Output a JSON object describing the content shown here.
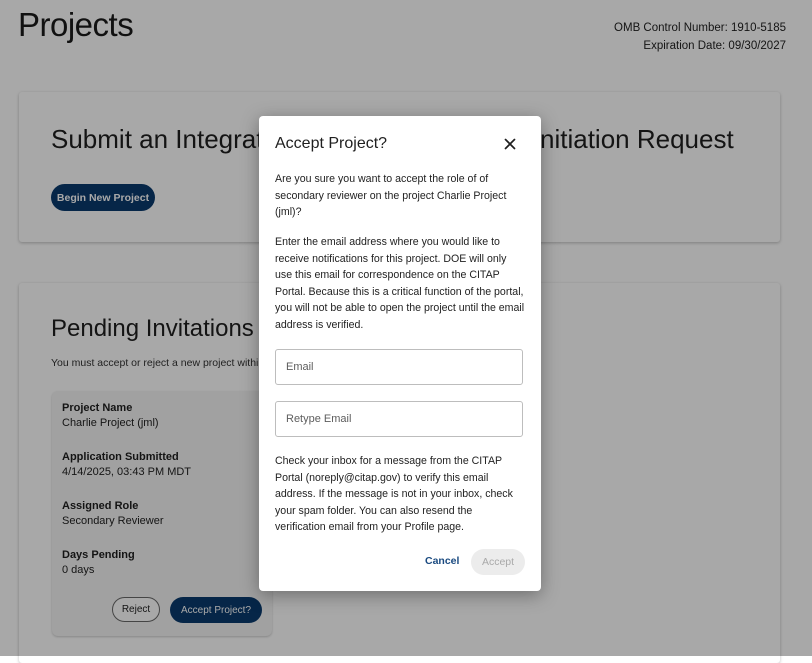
{
  "page": {
    "title": "Projects",
    "omb": {
      "control_number": "OMB Control Number: 1910-5185",
      "expiration": "Expiration Date: 09/30/2027"
    }
  },
  "submit_card": {
    "heading_left": "Submit an Integrated",
    "heading_right": "nitiation Request",
    "begin_button": "Begin New Project"
  },
  "pending": {
    "heading": "Pending Invitations",
    "note": "You must accept or reject a new project within",
    "invitation": {
      "project_name_label": "Project Name",
      "project_name_value": "Charlie Project (jml)",
      "submitted_label": "Application Submitted",
      "submitted_value": "4/14/2025, 03:43 PM MDT",
      "role_label": "Assigned Role",
      "role_value": "Secondary Reviewer",
      "days_label": "Days Pending",
      "days_value": "0 days",
      "reject_button": "Reject",
      "accept_button": "Accept Project?"
    }
  },
  "modal": {
    "title": "Accept Project?",
    "close_icon": "close-icon",
    "confirm_text": "Are you sure you want to accept the role of of secondary reviewer on the project Charlie Project (jml)?",
    "email_instructions": "Enter the email address where you would like to receive notifications for this project. DOE will only use this email for correspondence on the CITAP Portal. Because this is a critical function of the portal, you will not be able to open the project until the email address is verified.",
    "email_placeholder": "Email",
    "email_value": "",
    "retype_placeholder": "Retype Email",
    "retype_value": "",
    "verify_text": "Check your inbox for a message from the CITAP Portal (noreply@citap.gov) to verify this email address. If the message is not in your inbox, check your spam folder. You can also resend the verification email from your Profile page.",
    "cancel_label": "Cancel",
    "accept_label": "Accept"
  },
  "colors": {
    "primary": "#0a3b6e",
    "link": "#1a4a80",
    "overlay": "rgba(0,0,0,0.34)",
    "disabled_bg": "#ececec",
    "disabled_text": "#a9a9a9"
  }
}
